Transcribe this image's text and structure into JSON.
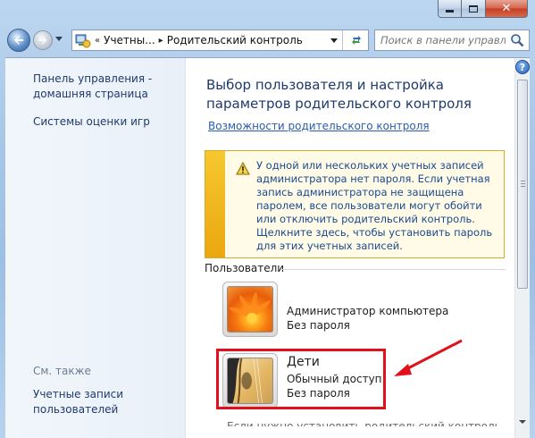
{
  "window": {
    "minimize_glyph": "minimize-icon",
    "maximize_glyph": "maximize-icon",
    "close_label": "✕"
  },
  "address_bar": {
    "overflow": "«",
    "breadcrumbs": [
      "Учетны...",
      "Родительский контроль"
    ],
    "separator": "▸"
  },
  "search": {
    "placeholder": "Поиск в панели управле..."
  },
  "sidebar": {
    "home_link": "Панель управления - домашняя страница",
    "game_ratings_link": "Системы оценки игр",
    "see_also_heading": "См. также",
    "user_accounts_link": "Учетные записи пользователей"
  },
  "main": {
    "title": "Выбор пользователя и настройка параметров родительского контроля",
    "features_link": "Возможности родительского контроля",
    "warning_text": "У одной или нескольких учетных записей администратора нет пароля. Если учетная запись администратора не защищена паролем, все пользователи могут обойти или отключить родительский контроль. Щелкните здесь, чтобы установить пароль для этих учетных записей.",
    "users_heading": "Пользователи",
    "users": [
      {
        "name": "Администратор компьютера",
        "lines": [
          "Без пароля"
        ],
        "avatar": "orange-flower"
      },
      {
        "name": "Дети",
        "lines": [
          "Обычный доступ",
          "Без пароля"
        ],
        "avatar": "guitar"
      }
    ],
    "cut_off_text": "Если нужно установить родительский контроль за"
  },
  "help_label": "?",
  "colors": {
    "highlight_box": "#e2101b",
    "annotation_arrow": "#e2101b",
    "link": "#2a5db0",
    "title": "#1e3a6b",
    "warning_bar": "#f0b61c"
  }
}
